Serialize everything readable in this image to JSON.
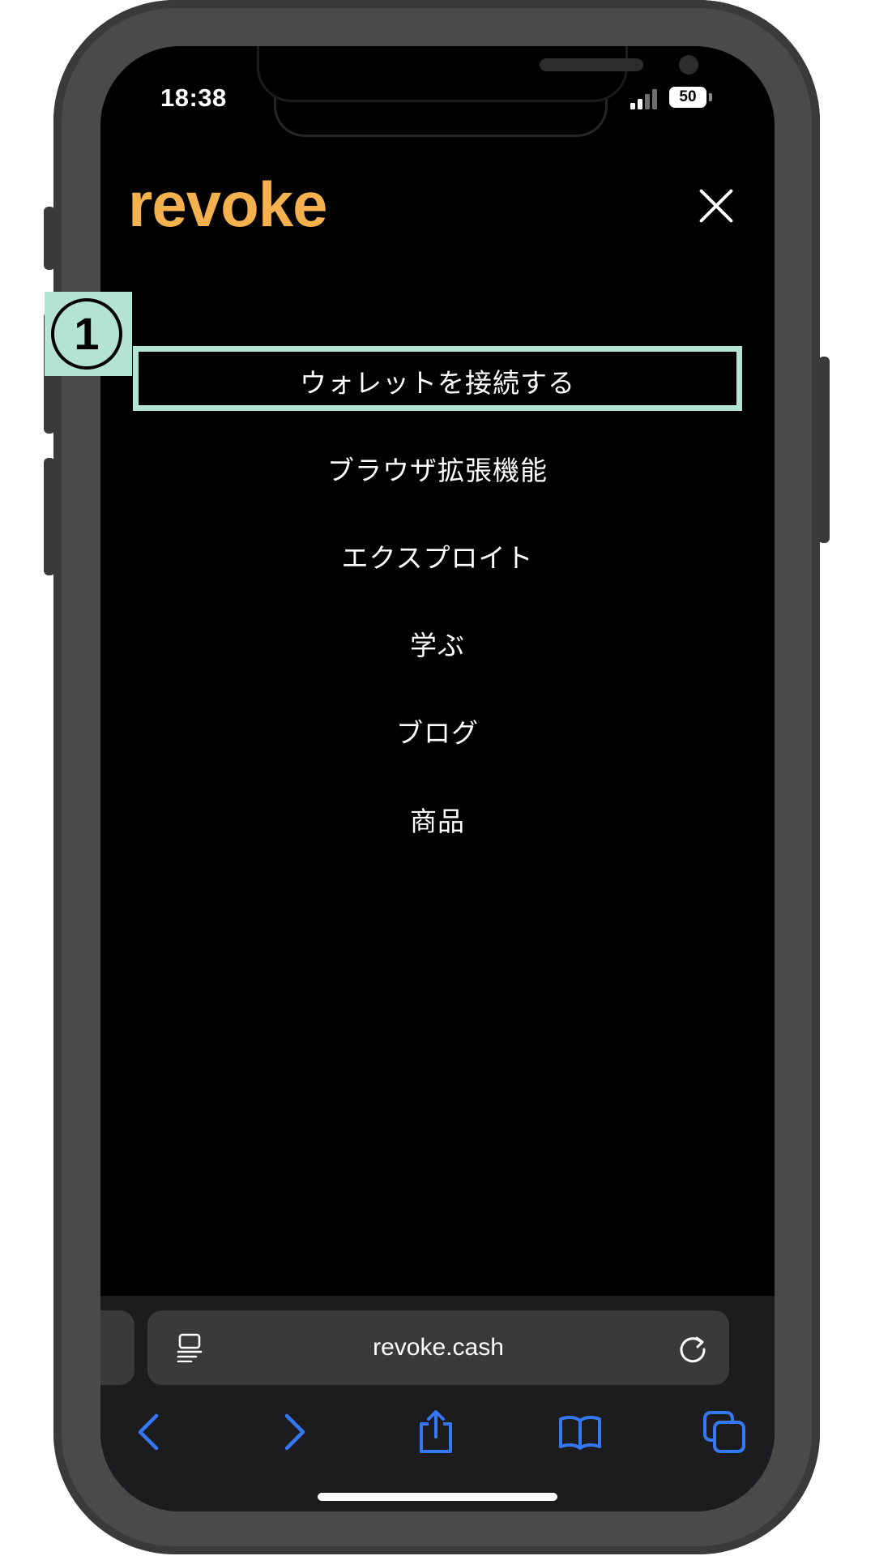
{
  "status_bar": {
    "time": "18:38",
    "battery": "50"
  },
  "header": {
    "logo": "revoke"
  },
  "menu": {
    "items": [
      {
        "label": "ウォレットを接続する"
      },
      {
        "label": "ブラウザ拡張機能"
      },
      {
        "label": "エクスプロイト"
      },
      {
        "label": "学ぶ"
      },
      {
        "label": "ブログ"
      },
      {
        "label": "商品"
      }
    ]
  },
  "annotation": {
    "marker": "1",
    "color": "#b2e3d3"
  },
  "browser": {
    "url": "revoke.cash"
  },
  "colors": {
    "brand": "#f5b14e",
    "background": "#000000",
    "safari_blue": "#3478f6"
  },
  "icons": [
    "close-icon",
    "page-menu-icon",
    "reload-icon",
    "back-icon",
    "forward-icon",
    "share-icon",
    "bookmarks-icon",
    "tabs-icon"
  ]
}
